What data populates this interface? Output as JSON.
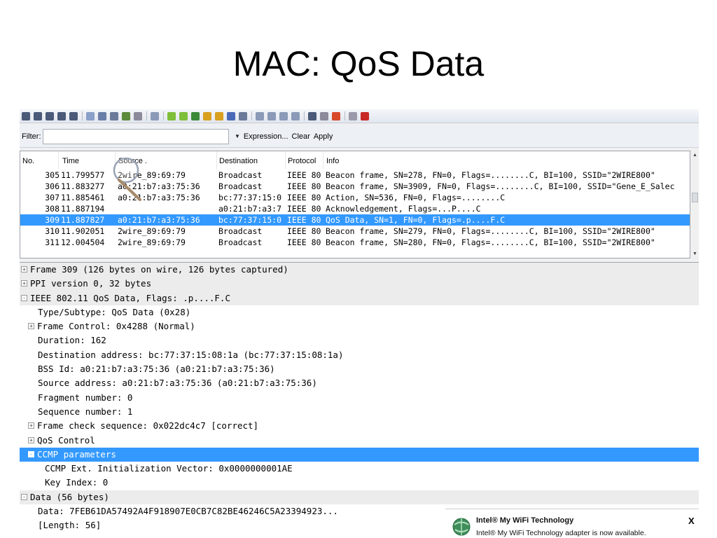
{
  "slide": {
    "title": "MAC: QoS Data"
  },
  "toolbar": {
    "icons": [
      {
        "name": "interfaces-icon",
        "color": "#4a5a78"
      },
      {
        "name": "options-icon",
        "color": "#4a5a78"
      },
      {
        "name": "start-capture-icon",
        "color": "#4a5a78"
      },
      {
        "name": "stop-capture-icon",
        "color": "#4a5a78"
      },
      {
        "name": "restart-capture-icon",
        "color": "#4a5a78"
      },
      {
        "name": "open-file-icon",
        "color": "#8aa0c8"
      },
      {
        "name": "save-file-icon",
        "color": "#6a7fa8"
      },
      {
        "name": "close-file-icon",
        "color": "#6a7a98"
      },
      {
        "name": "reload-icon",
        "color": "#5a8a3a"
      },
      {
        "name": "print-icon",
        "color": "#8a8a9a"
      },
      {
        "name": "find-icon",
        "color": "#8a9ab8"
      },
      {
        "name": "back-icon",
        "color": "#7fbf3a"
      },
      {
        "name": "forward-icon",
        "color": "#7fbf3a"
      },
      {
        "name": "go-to-packet-icon",
        "color": "#3a8a3a"
      },
      {
        "name": "first-packet-icon",
        "color": "#d9a020"
      },
      {
        "name": "last-packet-icon",
        "color": "#d9a020"
      },
      {
        "name": "autoscroll-icon",
        "color": "#4a6ab8"
      },
      {
        "name": "colorize-icon",
        "color": "#6a7a98"
      },
      {
        "name": "zoom-in-icon",
        "color": "#8a9ab8"
      },
      {
        "name": "zoom-out-icon",
        "color": "#8a9ab8"
      },
      {
        "name": "normal-size-icon",
        "color": "#8a9ab8"
      },
      {
        "name": "resize-columns-icon",
        "color": "#8a9ab8"
      },
      {
        "name": "capture-filters-icon",
        "color": "#4a5a78"
      },
      {
        "name": "display-filters-icon",
        "color": "#8a8a9a"
      },
      {
        "name": "coloring-rules-icon",
        "color": "#d8482a"
      },
      {
        "name": "preferences-icon",
        "color": "#9a9aaa"
      },
      {
        "name": "help-icon",
        "color": "#c82a2a"
      }
    ]
  },
  "filter": {
    "label": "Filter:",
    "value": "",
    "expression": "Expression...",
    "clear": "Clear",
    "apply": "Apply"
  },
  "packet_list": {
    "headers": {
      "no": "No.",
      "time": "Time",
      "source": "Source .",
      "destination": "Destination",
      "protocol": "Protocol",
      "info": "Info"
    },
    "rows": [
      {
        "no": "305",
        "time": "11.799577",
        "source": "2wire_89:69:79",
        "destination": "Broadcast",
        "protocol": "IEEE 80",
        "info": "Beacon frame, SN=278, FN=0, Flags=........C, BI=100, SSID=\"2WIRE800\""
      },
      {
        "no": "306",
        "time": "11.883277",
        "source": "a0:21:b7:a3:75:36",
        "destination": "Broadcast",
        "protocol": "IEEE 80",
        "info": "Beacon frame, SN=3909, FN=0, Flags=........C, BI=100, SSID=\"Gene_E_Salec"
      },
      {
        "no": "307",
        "time": "11.885461",
        "source": "a0:21:b7:a3:75:36",
        "destination": "bc:77:37:15:0",
        "protocol": "IEEE 80",
        "info": "Action, SN=536, FN=0, Flags=........C"
      },
      {
        "no": "308",
        "time": "11.887194",
        "source": "",
        "destination": "a0:21:b7:a3:7",
        "protocol": "IEEE 80",
        "info": "Acknowledgement, Flags=...P....C"
      },
      {
        "no": "309",
        "time": "11.887827",
        "source": "a0:21:b7:a3:75:36",
        "destination": "bc:77:37:15:0",
        "protocol": "IEEE 80",
        "info": "QoS Data, SN=1, FN=0, Flags=.p....F.C",
        "selected": true
      },
      {
        "no": "310",
        "time": "11.902051",
        "source": "2wire_89:69:79",
        "destination": "Broadcast",
        "protocol": "IEEE 80",
        "info": "Beacon frame, SN=279, FN=0, Flags=........C, BI=100, SSID=\"2WIRE800\""
      },
      {
        "no": "311",
        "time": "12.004504",
        "source": "2wire_89:69:79",
        "destination": "Broadcast",
        "protocol": "IEEE 80",
        "info": "Beacon frame, SN=280, FN=0, Flags=........C, BI=100, SSID=\"2WIRE800\""
      }
    ]
  },
  "details": {
    "rows": [
      {
        "text": "Frame 309 (126 bytes on wire, 126 bytes captured)",
        "toggle": "+",
        "level": "lvl0",
        "shade": true
      },
      {
        "text": "PPI version 0, 32 bytes",
        "toggle": "+",
        "level": "lvl0",
        "shade": true
      },
      {
        "text": "IEEE 802.11 QoS Data, Flags: .p....F.C",
        "toggle": "-",
        "level": "lvl0",
        "shade": true
      },
      {
        "text": "Type/Subtype: QoS Data (0x28)",
        "level": "lvl1"
      },
      {
        "text": "Frame Control: 0x4288 (Normal)",
        "toggle": "+",
        "level": "lvl1t"
      },
      {
        "text": "Duration: 162",
        "level": "lvl1"
      },
      {
        "text": "Destination address: bc:77:37:15:08:1a (bc:77:37:15:08:1a)",
        "level": "lvl1"
      },
      {
        "text": "BSS Id: a0:21:b7:a3:75:36 (a0:21:b7:a3:75:36)",
        "level": "lvl1"
      },
      {
        "text": "Source address: a0:21:b7:a3:75:36 (a0:21:b7:a3:75:36)",
        "level": "lvl1"
      },
      {
        "text": "Fragment number: 0",
        "level": "lvl1"
      },
      {
        "text": "Sequence number: 1",
        "level": "lvl1"
      },
      {
        "text": "Frame check sequence: 0x022dc4c7 [correct]",
        "toggle": "+",
        "level": "lvl1t"
      },
      {
        "text": "QoS Control",
        "toggle": "+",
        "level": "lvl1t"
      },
      {
        "text": "CCMP parameters",
        "toggle": "-",
        "level": "lvl1t",
        "selected": true
      },
      {
        "text": "CCMP Ext. Initialization Vector: 0x0000000001AE",
        "level": "lvl2"
      },
      {
        "text": "Key Index: 0",
        "level": "lvl2"
      },
      {
        "text": "Data (56 bytes)",
        "toggle": "-",
        "level": "lvl0",
        "shade": true
      },
      {
        "text": "Data: 7FEB61DA57492A4F918907E0CB7C82BE46246C5A23394923...",
        "level": "lvl1"
      },
      {
        "text": "[Length: 56]",
        "level": "lvl1"
      }
    ]
  },
  "notification": {
    "title": "Intel® My WiFi Technology",
    "message": "Intel® My WiFi Technology adapter is now available.",
    "close": "X"
  }
}
